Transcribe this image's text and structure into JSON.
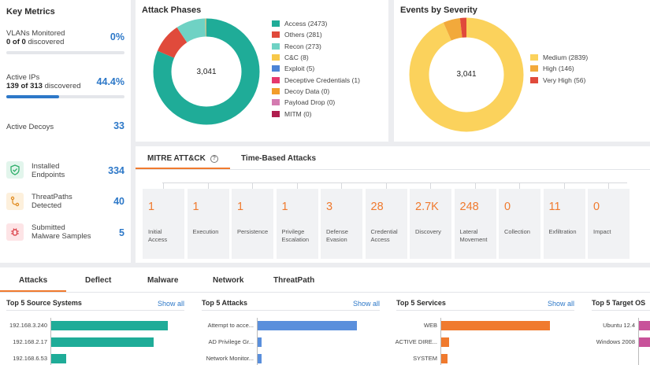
{
  "key_metrics": {
    "title": "Key Metrics",
    "vlans": {
      "label": "VLANs Monitored",
      "sub_a": "0 of 0",
      "sub_b": "discovered",
      "value": "0%",
      "progress": 0
    },
    "ips": {
      "label": "Active IPs",
      "sub_a": "139 of 313",
      "sub_b": "discovered",
      "value": "44.4%",
      "progress": 44.4
    },
    "decoys": {
      "label": "Active Decoys",
      "value": "33"
    },
    "endpoints": {
      "label_1": "Installed",
      "label_2": "Endpoints",
      "value": "334",
      "icon": "shield-check-icon"
    },
    "threatpaths": {
      "label_1": "ThreatPaths",
      "label_2": "Detected",
      "value": "40",
      "icon": "path-icon"
    },
    "malware": {
      "label_1": "Submitted",
      "label_2": "Malware Samples",
      "value": "5",
      "icon": "bug-icon"
    }
  },
  "attack_phases": {
    "title": "Attack Phases",
    "total": "3,041",
    "items": [
      {
        "label": "Access (2473)",
        "value": 2473,
        "color": "#1fac98"
      },
      {
        "label": "Others (281)",
        "value": 281,
        "color": "#e04a3b"
      },
      {
        "label": "Recon (273)",
        "value": 273,
        "color": "#6fd2c4"
      },
      {
        "label": "C&C (8)",
        "value": 8,
        "color": "#f7c84a"
      },
      {
        "label": "Exploit (5)",
        "value": 5,
        "color": "#4c84d6"
      },
      {
        "label": "Deceptive Credentials (1)",
        "value": 1,
        "color": "#e5386e"
      },
      {
        "label": "Decoy Data (0)",
        "value": 0,
        "color": "#f29d2a"
      },
      {
        "label": "Payload Drop (0)",
        "value": 0,
        "color": "#d47bb0"
      },
      {
        "label": "MITM (0)",
        "value": 0,
        "color": "#b01e4e"
      }
    ]
  },
  "events_by_severity": {
    "title": "Events by Severity",
    "total": "3,041",
    "items": [
      {
        "label": "Medium (2839)",
        "value": 2839,
        "color": "#fbd25c"
      },
      {
        "label": "High (146)",
        "value": 146,
        "color": "#f2a93b"
      },
      {
        "label": "Very High (56)",
        "value": 56,
        "color": "#e04a3b"
      }
    ]
  },
  "mitre": {
    "tab_active": "MITRE ATT&CK",
    "tab_other": "Time-Based Attacks",
    "help_icon": "help-circle-icon",
    "phases": [
      {
        "value": "1",
        "label_1": "Initial",
        "label_2": "Access"
      },
      {
        "value": "1",
        "label_1": "Execution",
        "label_2": ""
      },
      {
        "value": "1",
        "label_1": "Persistence",
        "label_2": ""
      },
      {
        "value": "1",
        "label_1": "Privilege",
        "label_2": "Escalation"
      },
      {
        "value": "3",
        "label_1": "Defense",
        "label_2": "Evasion"
      },
      {
        "value": "28",
        "label_1": "Credential",
        "label_2": "Access"
      },
      {
        "value": "2.7K",
        "label_1": "Discovery",
        "label_2": ""
      },
      {
        "value": "248",
        "label_1": "Lateral",
        "label_2": "Movement"
      },
      {
        "value": "0",
        "label_1": "Collection",
        "label_2": ""
      },
      {
        "value": "11",
        "label_1": "Exfiltration",
        "label_2": ""
      },
      {
        "value": "0",
        "label_1": "Impact",
        "label_2": ""
      }
    ]
  },
  "bottom": {
    "tabs": [
      "Attacks",
      "Deflect",
      "Malware",
      "Network",
      "ThreatPath"
    ],
    "show_all": "Show all",
    "source_systems": {
      "title": "Top 5 Source Systems",
      "rows": [
        {
          "label": "192.168.3.240",
          "value": 1.0
        },
        {
          "label": "192.168.2.17",
          "value": 0.88
        },
        {
          "label": "192.168.6.53",
          "value": 0.13
        }
      ],
      "color": "#1fac98"
    },
    "attacks": {
      "title": "Top 5 Attacks",
      "rows": [
        {
          "label": "Attempt to acce...",
          "value": 1.0
        },
        {
          "label": "AD Privilege Gr...",
          "value": 0.04
        },
        {
          "label": "Network Monitor...",
          "value": 0.04
        }
      ],
      "color": "#5a8fdc"
    },
    "services": {
      "title": "Top 5 Services",
      "rows": [
        {
          "label": "WEB",
          "value": 1.0
        },
        {
          "label": "ACTIVE DIRE...",
          "value": 0.07
        },
        {
          "label": "SYSTEM",
          "value": 0.06
        }
      ],
      "color": "#f07a2e"
    },
    "target_os": {
      "title": "Top 5 Target OS",
      "rows": [
        {
          "label": "Ubuntu 12.4",
          "value": 1.0
        },
        {
          "label": "Windows 2008",
          "value": 1.0
        }
      ],
      "color": "#c8529a"
    }
  }
}
